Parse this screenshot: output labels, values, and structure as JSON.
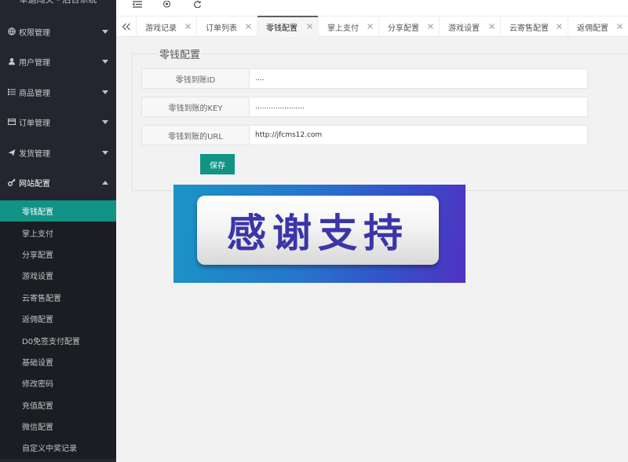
{
  "app": {
    "title": "幸运闯关 - 后台系统"
  },
  "sidebar": {
    "groups": [
      {
        "label": "权限管理",
        "icon": "globe-icon",
        "expanded": false
      },
      {
        "label": "用户管理",
        "icon": "user-icon",
        "expanded": false
      },
      {
        "label": "商品管理",
        "icon": "list-icon",
        "expanded": false
      },
      {
        "label": "订单管理",
        "icon": "card-icon",
        "expanded": false
      },
      {
        "label": "发货管理",
        "icon": "send-icon",
        "expanded": false
      },
      {
        "label": "网站配置",
        "icon": "key-icon",
        "expanded": true
      }
    ],
    "sub_items": [
      {
        "label": "零钱配置",
        "active": true
      },
      {
        "label": "掌上支付"
      },
      {
        "label": "分享配置"
      },
      {
        "label": "游戏设置"
      },
      {
        "label": "云寄售配置"
      },
      {
        "label": "返佣配置"
      },
      {
        "label": "D0免签支付配置"
      },
      {
        "label": "基础设置"
      },
      {
        "label": "修改密码"
      },
      {
        "label": "充值配置"
      },
      {
        "label": "微信配置"
      },
      {
        "label": "自定义中奖记录"
      }
    ],
    "colors": {
      "bg": "#23262e",
      "active": "#119386"
    }
  },
  "header": {
    "icons": [
      "shrink-menu-icon",
      "theme-icon",
      "refresh-icon"
    ]
  },
  "tabs": [
    {
      "label": "游戏记录"
    },
    {
      "label": "订单列表"
    },
    {
      "label": "零钱配置",
      "active": true
    },
    {
      "label": "掌上支付"
    },
    {
      "label": "分享配置"
    },
    {
      "label": "游戏设置"
    },
    {
      "label": "云寄售配置"
    },
    {
      "label": "返佣配置"
    }
  ],
  "form": {
    "legend": "零钱配置",
    "fields": [
      {
        "label": "零钱到账ID",
        "value": "....",
        "type": "password"
      },
      {
        "label": "零钱到账的KEY",
        "value": "......................",
        "type": "password"
      },
      {
        "label": "零钱到账的URL",
        "value": "http://jfcms12.com",
        "type": "text"
      }
    ],
    "save_label": "保存"
  },
  "banner": {
    "text": "感谢支持"
  }
}
